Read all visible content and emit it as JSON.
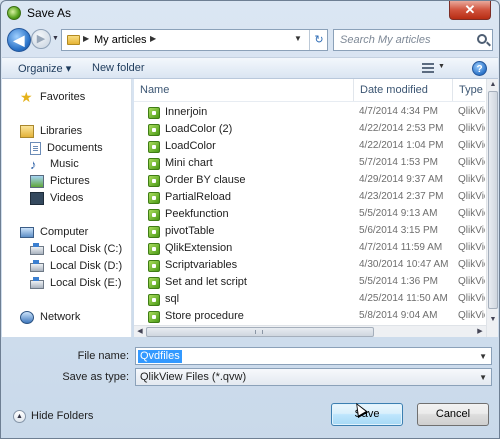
{
  "window": {
    "title": "Save As",
    "close_glyph": "✕"
  },
  "nav": {
    "back_glyph": "◀",
    "forward_glyph": "▶",
    "breadcrumb": "My articles",
    "search_placeholder": "Search My articles"
  },
  "toolbar": {
    "organize": "Organize ▾",
    "new_folder": "New folder",
    "help_glyph": "?"
  },
  "sidebar": {
    "favorites": "Favorites",
    "libraries": "Libraries",
    "documents": "Documents",
    "music": "Music",
    "pictures": "Pictures",
    "videos": "Videos",
    "computer": "Computer",
    "disk_c": "Local Disk (C:)",
    "disk_d": "Local Disk (D:)",
    "disk_e": "Local Disk (E:)",
    "network": "Network"
  },
  "columns": {
    "name": "Name",
    "date": "Date modified",
    "type": "Type"
  },
  "files": [
    {
      "name": "Innerjoin",
      "date": "4/7/2014 4:34 PM",
      "type": "QlikVie"
    },
    {
      "name": "LoadColor (2)",
      "date": "4/22/2014 2:53 PM",
      "type": "QlikVie"
    },
    {
      "name": "LoadColor",
      "date": "4/22/2014 1:04 PM",
      "type": "QlikVie"
    },
    {
      "name": "Mini chart",
      "date": "5/7/2014 1:53 PM",
      "type": "QlikVie"
    },
    {
      "name": "Order BY clause",
      "date": "4/29/2014 9:37 AM",
      "type": "QlikVie"
    },
    {
      "name": "PartialReload",
      "date": "4/23/2014 2:37 PM",
      "type": "QlikVie"
    },
    {
      "name": "Peekfunction",
      "date": "5/5/2014 9:13 AM",
      "type": "QlikVie"
    },
    {
      "name": "pivotTable",
      "date": "5/6/2014 3:15 PM",
      "type": "QlikVie"
    },
    {
      "name": "QlikExtension",
      "date": "4/7/2014 11:59 AM",
      "type": "QlikVie"
    },
    {
      "name": "Scriptvariables",
      "date": "4/30/2014 10:47 AM",
      "type": "QlikVie"
    },
    {
      "name": "Set and let script",
      "date": "5/5/2014 1:36 PM",
      "type": "QlikVie"
    },
    {
      "name": "sql",
      "date": "4/25/2014 11:50 AM",
      "type": "QlikVie"
    },
    {
      "name": "Store procedure",
      "date": "5/8/2014 9:04 AM",
      "type": "QlikVie"
    }
  ],
  "form": {
    "file_name_label": "File name:",
    "file_name_value": "Qvdfiles",
    "save_type_label": "Save as type:",
    "save_type_value": "QlikView Files (*.qvw)"
  },
  "footer": {
    "hide_folders": "Hide Folders",
    "save": "Save",
    "cancel": "Cancel"
  },
  "colors": {
    "selection": "#3399ff",
    "file_icon": "#4b9a16",
    "close": "#c7432b"
  }
}
